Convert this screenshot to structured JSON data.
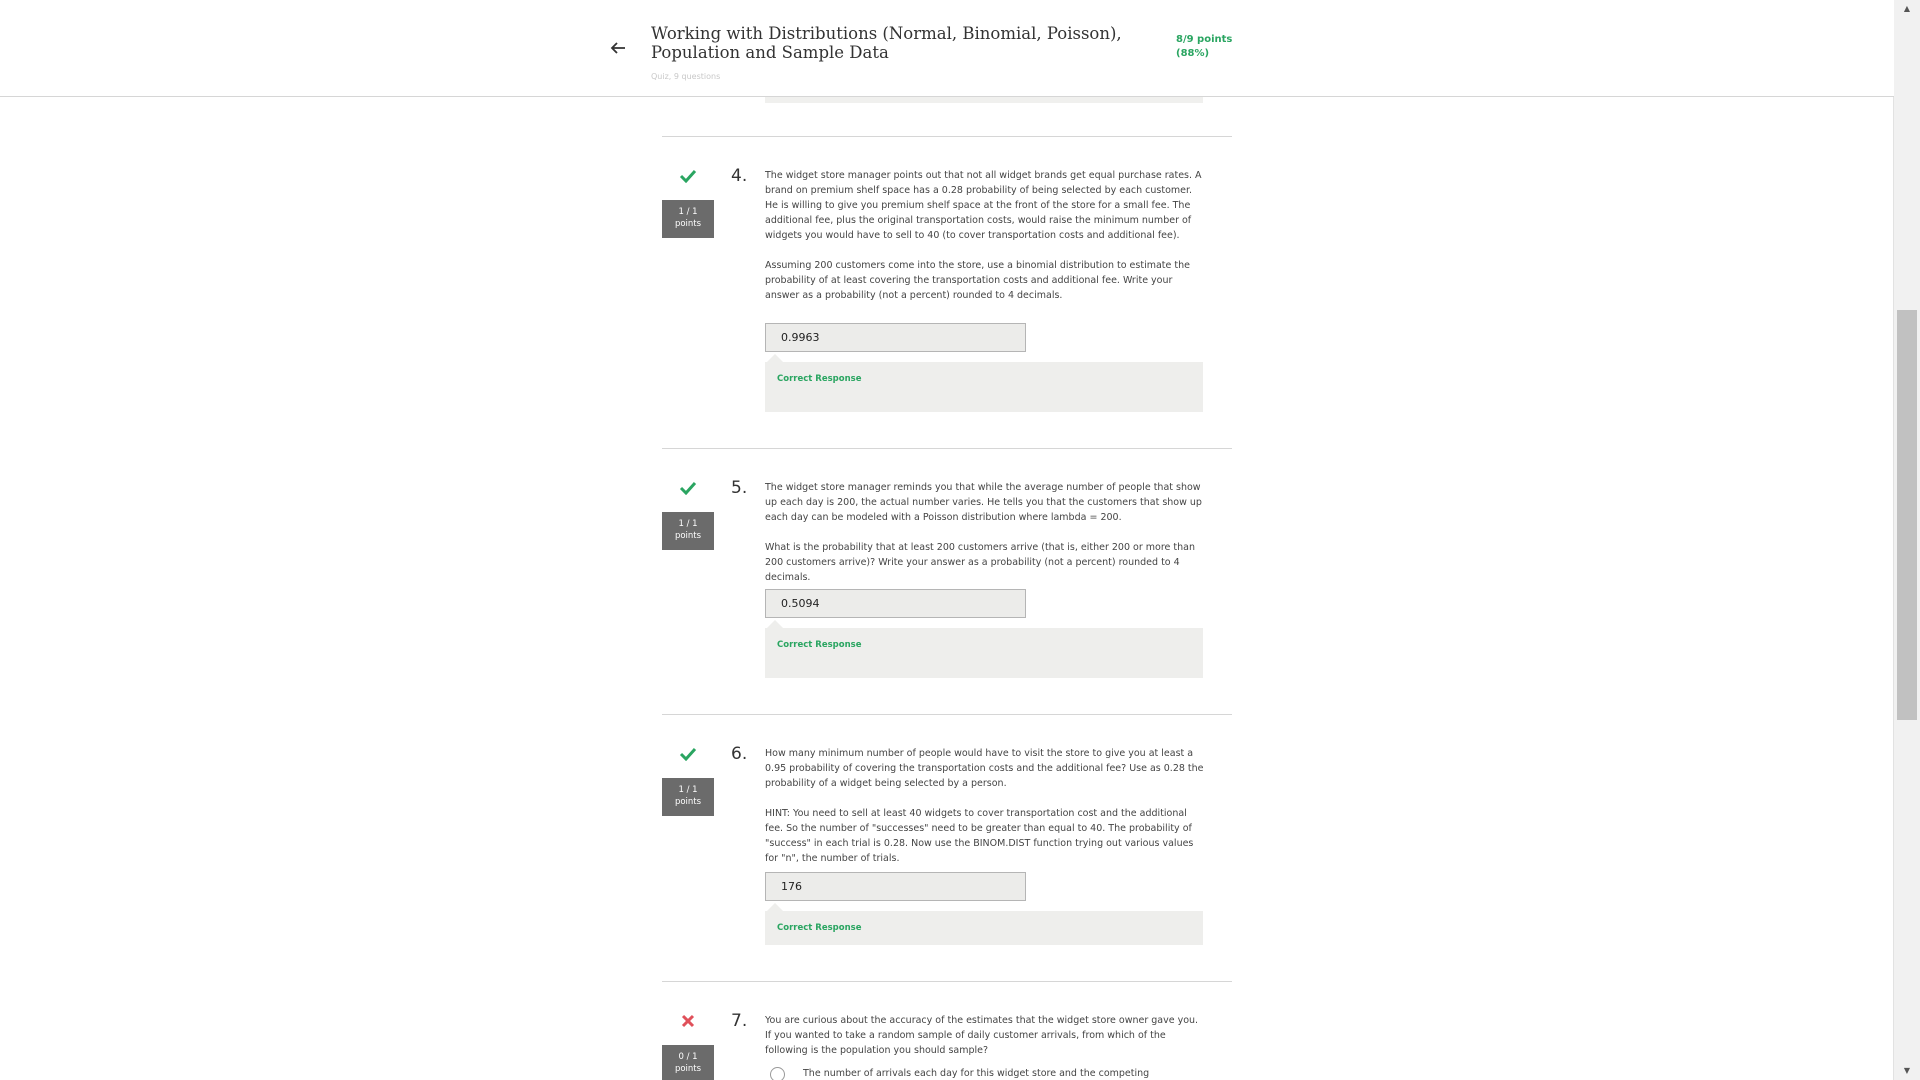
{
  "header": {
    "title": "Working with Distributions (Normal, Binomial, Poisson), Population and Sample Data",
    "subtitle": "Quiz, 9 questions",
    "score_line1": "8/9 points",
    "score_line2": "(88%)",
    "back_icon": "arrow-left-icon"
  },
  "colors": {
    "accent_green": "#2aa561",
    "wrong_red": "#e0505a",
    "badge_gray": "#6b6b6b"
  },
  "questions": [
    {
      "number": "4.",
      "status": "correct",
      "points_line1": "1 / 1",
      "points_line2": "points",
      "text_p1": "The widget store manager points out that not all widget brands get equal purchase rates. A brand on premium shelf space has a 0.28 probability of being selected by each customer. He is willing to give you premium shelf space at the front of the store for a small fee. The additional fee, plus the original transportation costs, would raise the minimum number of widgets you would have to sell to 40 (to cover transportation costs and additional fee).",
      "text_p2": "Assuming 200 customers come into the store, use a binomial distribution to estimate the probability of at least covering the transportation costs and additional fee. Write your answer as a probability (not a percent) rounded to 4 decimals.",
      "answer": "0.9963",
      "feedback": "Correct Response"
    },
    {
      "number": "5.",
      "status": "correct",
      "points_line1": "1 / 1",
      "points_line2": "points",
      "text_p1": "The widget store manager reminds you that while the average number of people that show up each day is 200, the actual number varies. He tells you that the customers that show up each day can be modeled with a Poisson distribution where lambda = 200.",
      "text_p2": "What is the probability that at least 200 customers arrive (that is, either 200 or more than 200 customers arrive)? Write your answer as a probability (not a percent) rounded to 4 decimals.",
      "answer": "0.5094",
      "feedback": "Correct Response"
    },
    {
      "number": "6.",
      "status": "correct",
      "points_line1": "1 / 1",
      "points_line2": "points",
      "text_p1": "How many minimum number of people would have to visit the store to give you at least a 0.95 probability of covering the transportation costs and the additional fee? Use as 0.28 the probability of a widget being selected by a person.",
      "text_p2": "HINT: You need to sell at least 40 widgets to cover transportation cost and the additional fee. So the number of \"successes\" need to be greater than equal to 40. The probability of \"success\" in each trial is 0.28. Now use the BINOM.DIST function trying out various values for \"n\", the number of trials.",
      "answer": "176",
      "feedback": "Correct Response"
    },
    {
      "number": "7.",
      "status": "incorrect",
      "points_line1": "0 / 1",
      "points_line2": "points",
      "text_p1": "You are curious about the accuracy of the estimates that the widget store owner gave you. If you wanted to take a random sample of daily customer arrivals, from which of the following is the population you should sample?",
      "option_1": "The number of arrivals each day for this widget store and the competing"
    }
  ]
}
